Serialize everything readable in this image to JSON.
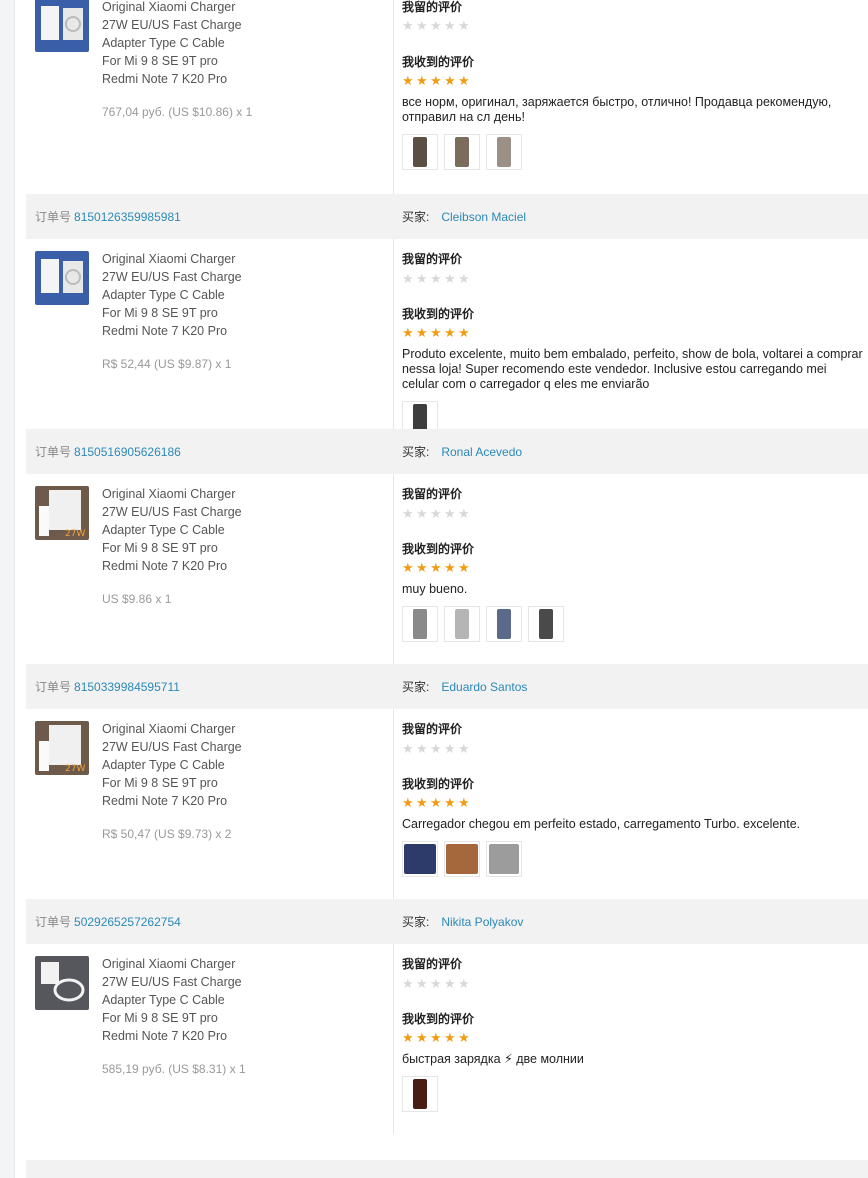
{
  "labels": {
    "order_no": "订单号",
    "buyer": "买家:",
    "my_review": "我留的评价",
    "received_review": "我收到的评价"
  },
  "product_title_lines": [
    "Original Xiaomi Charger",
    "27W EU/US Fast Charge",
    "Adapter Type C Cable",
    "For Mi 9 8 SE 9T pro",
    "Redmi Note 7 K20 Pro"
  ],
  "orders": [
    {
      "order_no": "",
      "buyer": "",
      "price": "767,04 руб. (US $10.86) x 1",
      "my_stars": 0,
      "received_stars": 5,
      "comment": "все норм, оригинал, заряжается быстро, отлично! Продавца рекомендую, отправил на сл день!",
      "photo_count": 3
    },
    {
      "order_no": "8150126359985981",
      "buyer": "Cleibson Maciel",
      "price": "R$ 52,44 (US $9.87) x 1",
      "my_stars": 0,
      "received_stars": 5,
      "comment": "Produto excelente, muito bem embalado, perfeito, show de bola, voltarei a comprar nessa loja! Super recomendo este vendedor. Inclusive estou carregando mei celular com o carregador q eles me enviarão",
      "photo_count": 1
    },
    {
      "order_no": "8150516905626186",
      "buyer": "Ronal Acevedo",
      "price": "US $9.86 x 1",
      "my_stars": 0,
      "received_stars": 5,
      "comment": "muy bueno.",
      "photo_count": 4
    },
    {
      "order_no": "8150339984595711",
      "buyer": "Eduardo Santos",
      "price": "R$ 50,47 (US $9.73) x 2",
      "my_stars": 0,
      "received_stars": 5,
      "comment": "Carregador chegou em perfeito estado, carregamento Turbo. excelente.",
      "photo_count": 3
    },
    {
      "order_no": "5029265257262754",
      "buyer": "Nikita Polyakov",
      "price": "585,19 руб. (US $8.31) x 1",
      "my_stars": 0,
      "received_stars": 5,
      "comment": "быстрая зарядка ⚡ две молнии",
      "photo_count": 1
    }
  ],
  "colors": {
    "link": "#2c89b8",
    "star_full": "#f39c12",
    "star_empty": "#d8d8d8",
    "header_bg": "#f2f2f2"
  }
}
